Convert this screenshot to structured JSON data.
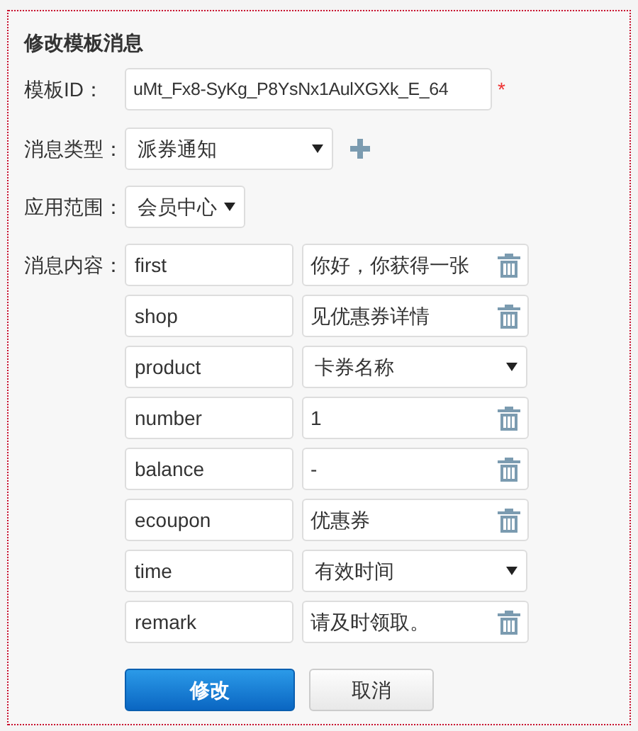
{
  "title": "修改模板消息",
  "template_id": {
    "label": "模板ID：",
    "value": "uMt_Fx8-SyKg_P8YsNx1AulXGXk_E_64",
    "required": true,
    "required_mark": "*"
  },
  "message_type": {
    "label": "消息类型：",
    "value": "派券通知"
  },
  "scope": {
    "label": "应用范围：",
    "value": "会员中心"
  },
  "content": {
    "label": "消息内容：",
    "rows": [
      {
        "key": "first",
        "kind": "text",
        "value": "你好，你获得一张"
      },
      {
        "key": "shop",
        "kind": "text",
        "value": "见优惠券详情"
      },
      {
        "key": "product",
        "kind": "select",
        "value": "卡券名称"
      },
      {
        "key": "number",
        "kind": "text",
        "value": "1"
      },
      {
        "key": "balance",
        "kind": "text",
        "value": "-"
      },
      {
        "key": "ecoupon",
        "kind": "text",
        "value": "优惠券"
      },
      {
        "key": "time",
        "kind": "select",
        "value": "有效时间"
      },
      {
        "key": "remark",
        "kind": "text",
        "value": "请及时领取。"
      }
    ]
  },
  "buttons": [
    {
      "label": "修改",
      "kind": "primary"
    },
    {
      "label": "取消",
      "kind": "secondary"
    }
  ]
}
